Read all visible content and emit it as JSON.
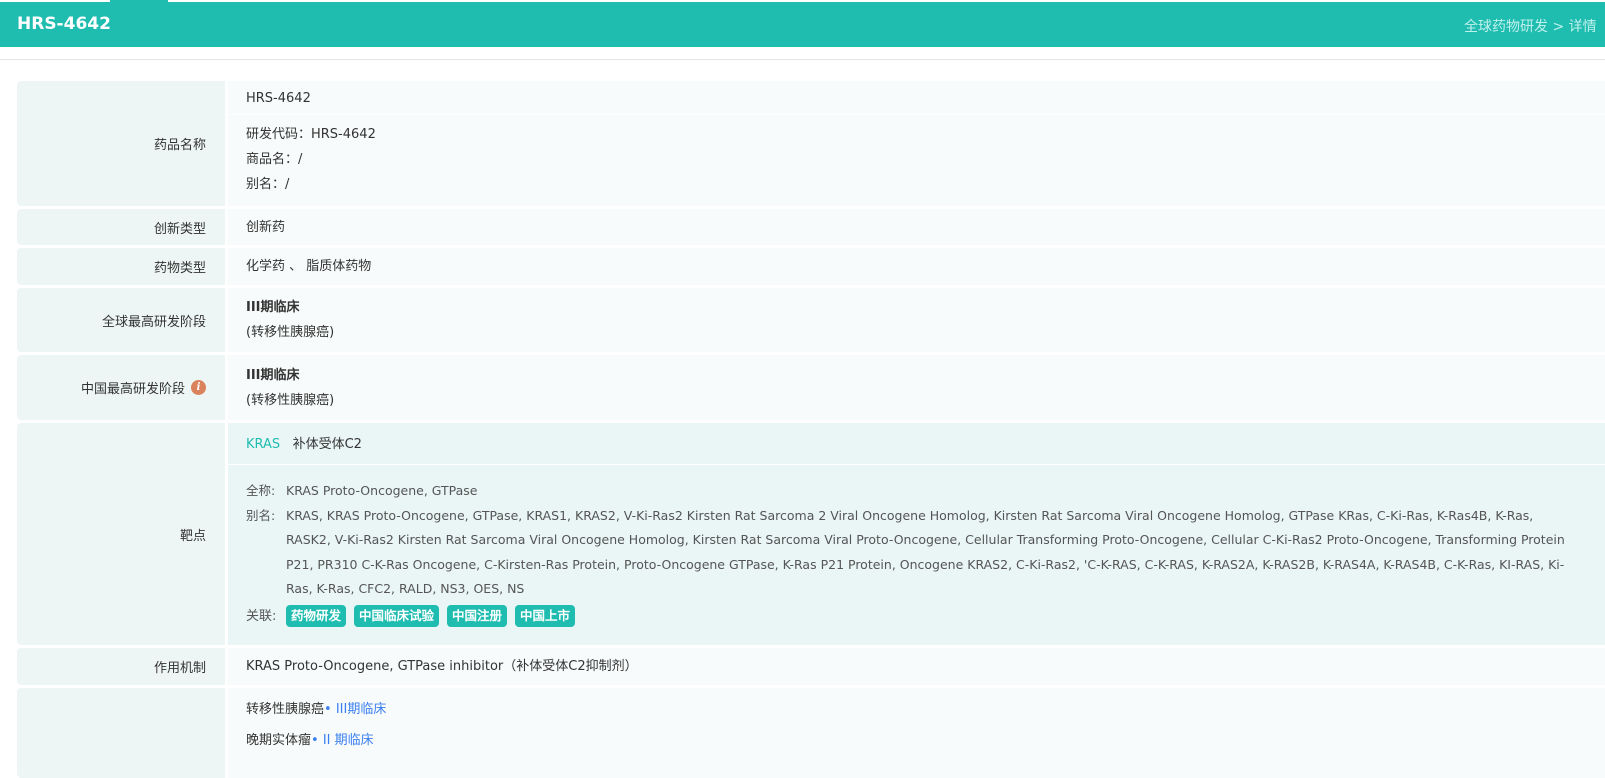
{
  "header": {
    "title": "HRS-4642",
    "breadcrumb": "全球药物研发 > 详情"
  },
  "rows": {
    "name": {
      "label": "药品名称",
      "main": "HRS-4642",
      "code": "研发代码：HRS-4642",
      "trade": "商品名：/",
      "alias": "别名：/"
    },
    "innovation": {
      "label": "创新类型",
      "value": "创新药"
    },
    "drug_type": {
      "label": "药物类型",
      "value": "化学药 、 脂质体药物"
    },
    "global_stage": {
      "label": "全球最高研发阶段",
      "stage": "III期临床",
      "indication": "(转移性胰腺癌)"
    },
    "china_stage": {
      "label": "中国最高研发阶段",
      "info_icon": "info-icon",
      "stage": "III期临床",
      "indication": "(转移性胰腺癌)"
    },
    "target": {
      "label": "靶点",
      "target_link": "KRAS",
      "target_cn": "补体受体C2",
      "fullname_key": "全称:",
      "fullname": "KRAS Proto-Oncogene, GTPase",
      "alias_key": "别名:",
      "alias": "KRAS, KRAS Proto-Oncogene, GTPase, KRAS1, KRAS2, V-Ki-Ras2 Kirsten Rat Sarcoma 2 Viral Oncogene Homolog, Kirsten Rat Sarcoma Viral Oncogene Homolog, GTPase KRas, C-Ki-Ras, K-Ras4B, K-Ras, RASK2, V-Ki-Ras2 Kirsten Rat Sarcoma Viral Oncogene Homolog, Kirsten Rat Sarcoma Viral Proto-Oncogene, Cellular Transforming Proto-Oncogene, Cellular C-Ki-Ras2 Proto-Oncogene, Transforming Protein P21, PR310 C-K-Ras Oncogene, C-Kirsten-Ras Protein, Proto-Oncogene GTPase, K-Ras P21 Protein, Oncogene KRAS2, C-Ki-Ras2, 'C-K-RAS, C-K-RAS, K-RAS2A, K-RAS2B, K-RAS4A, K-RAS4B, C-K-Ras, KI-RAS, Ki-Ras, K-Ras, CFC2, RALD, NS3, OES, NS",
      "related_key": "关联:",
      "tags": [
        "药物研发",
        "中国临床试验",
        "中国注册",
        "中国上市"
      ]
    },
    "mechanism": {
      "label": "作用机制",
      "value": "KRAS Proto-Oncogene, GTPase inhibitor（补体受体C2抑制剂）"
    },
    "indications": {
      "items": [
        {
          "name": "转移性胰腺癌",
          "stage": "• III期临床"
        },
        {
          "name": "晚期实体瘤",
          "stage": "• II 期临床"
        }
      ]
    }
  }
}
